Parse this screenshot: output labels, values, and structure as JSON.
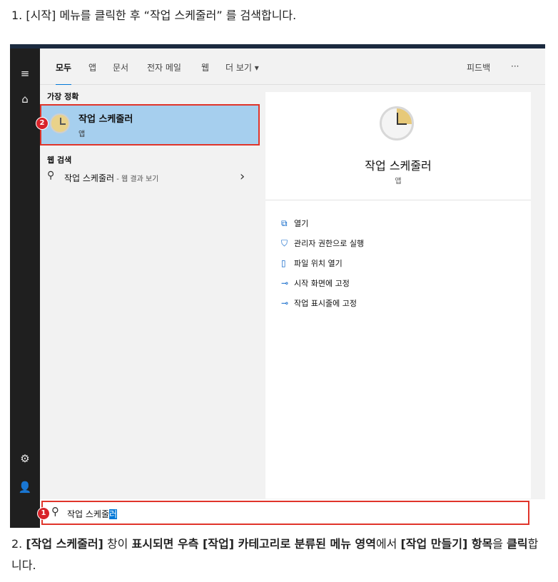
{
  "instructions": {
    "step1": "1. [시작] 메뉴를 클릭한 후 “작업 스케줄러” 를 검색합니다.",
    "step2": {
      "p1": "2. ",
      "b1": "[작업 스케줄러]",
      "p2": " 창이 ",
      "b2": "표시되면 우측 [작업] 카테고리로 분류된 메뉴 영역",
      "p3": "에서 ",
      "b3": "[작업 만들기] 항목",
      "p4": "을 ",
      "b4": "클릭",
      "p5": "합니다."
    }
  },
  "tabs": [
    {
      "label": "모두",
      "active": true
    },
    {
      "label": "앱"
    },
    {
      "label": "문서"
    },
    {
      "label": "전자 메일"
    },
    {
      "label": "웹"
    },
    {
      "label": "더 보기 ▾"
    }
  ],
  "header_right": {
    "feedback": "피드백",
    "more": "···"
  },
  "left": {
    "best_match_title": "가장 정확",
    "best_match": {
      "name": "작업 스케줄러",
      "type": "앱"
    },
    "web_search_title": "웹 검색",
    "web_result": {
      "query": "작업 스케줄러",
      "suffix": " - 웹 결과 보기",
      "arrow": "›"
    }
  },
  "right": {
    "app_name": "작업 스케줄러",
    "app_type": "앱",
    "actions": [
      "열기",
      "관리자 권한으로 실행",
      "파일 위치 열기",
      "시작 화면에 고정",
      "작업 표시줄에 고정"
    ],
    "action_icons": [
      "open-icon",
      "admin-shield-icon",
      "file-location-icon",
      "pin-start-icon",
      "pin-taskbar-icon"
    ]
  },
  "search": {
    "prefix": "작업 스케줄",
    "selected": "러"
  },
  "badges": [
    "1",
    "2"
  ],
  "rail_icons": [
    "hamburger-icon",
    "home-icon",
    "settings-icon",
    "user-icon"
  ],
  "colors": {
    "accent": "#0078d7",
    "highlight": "#a6cfee",
    "annotation": "#e0342a",
    "rail": "#1f1f1f"
  }
}
